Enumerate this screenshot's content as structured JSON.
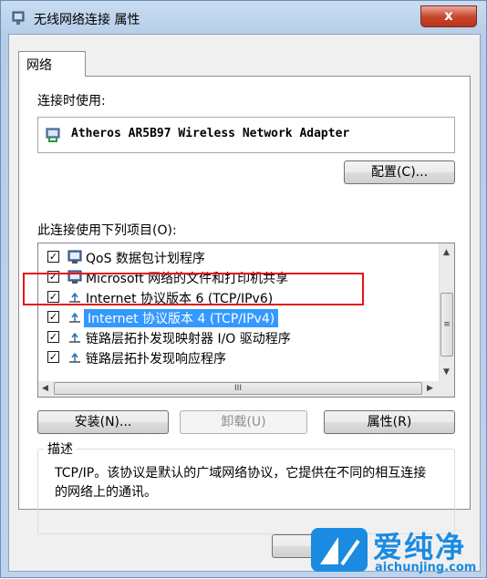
{
  "window": {
    "title": "无线网络连接 属性",
    "close_label": "x"
  },
  "tab": {
    "label": "网络"
  },
  "connect_using": {
    "label": "连接时使用:",
    "adapter": "Atheros AR5B97 Wireless Network Adapter"
  },
  "configure_button": "配置(C)...",
  "items_label": "此连接使用下列项目(O):",
  "items": [
    {
      "label": "QoS 数据包计划程序",
      "checked": true,
      "icon": "qos-icon"
    },
    {
      "label": "Microsoft 网络的文件和打印机共享",
      "checked": true,
      "icon": "file-share-icon"
    },
    {
      "label": "Internet 协议版本 6 (TCP/IPv6)",
      "checked": true,
      "icon": "protocol-icon"
    },
    {
      "label": "Internet 协议版本 4 (TCP/IPv4)",
      "checked": true,
      "icon": "protocol-icon",
      "selected": true
    },
    {
      "label": "链路层拓扑发现映射器 I/O 驱动程序",
      "checked": true,
      "icon": "protocol-icon"
    },
    {
      "label": "链路层拓扑发现响应程序",
      "checked": true,
      "icon": "protocol-icon"
    }
  ],
  "scroll": {
    "up": "▲",
    "down": "▼",
    "left": "◀",
    "right": "▶",
    "grip_v": "≡",
    "grip_h": "III"
  },
  "buttons": {
    "install": "安装(N)...",
    "uninstall": "卸载(U)",
    "properties": "属性(R)"
  },
  "description": {
    "title": "描述",
    "text": "TCP/IP。该协议是默认的广域网络协议，它提供在不同的相互连接的网络上的通讯。"
  },
  "watermark": {
    "name": "爱纯净",
    "url": "aichunjing.com"
  },
  "colors": {
    "selection": "#3399ff",
    "highlight_box": "#e4141c",
    "close_button": "#c8492f",
    "watermark": "#1a8be0"
  }
}
